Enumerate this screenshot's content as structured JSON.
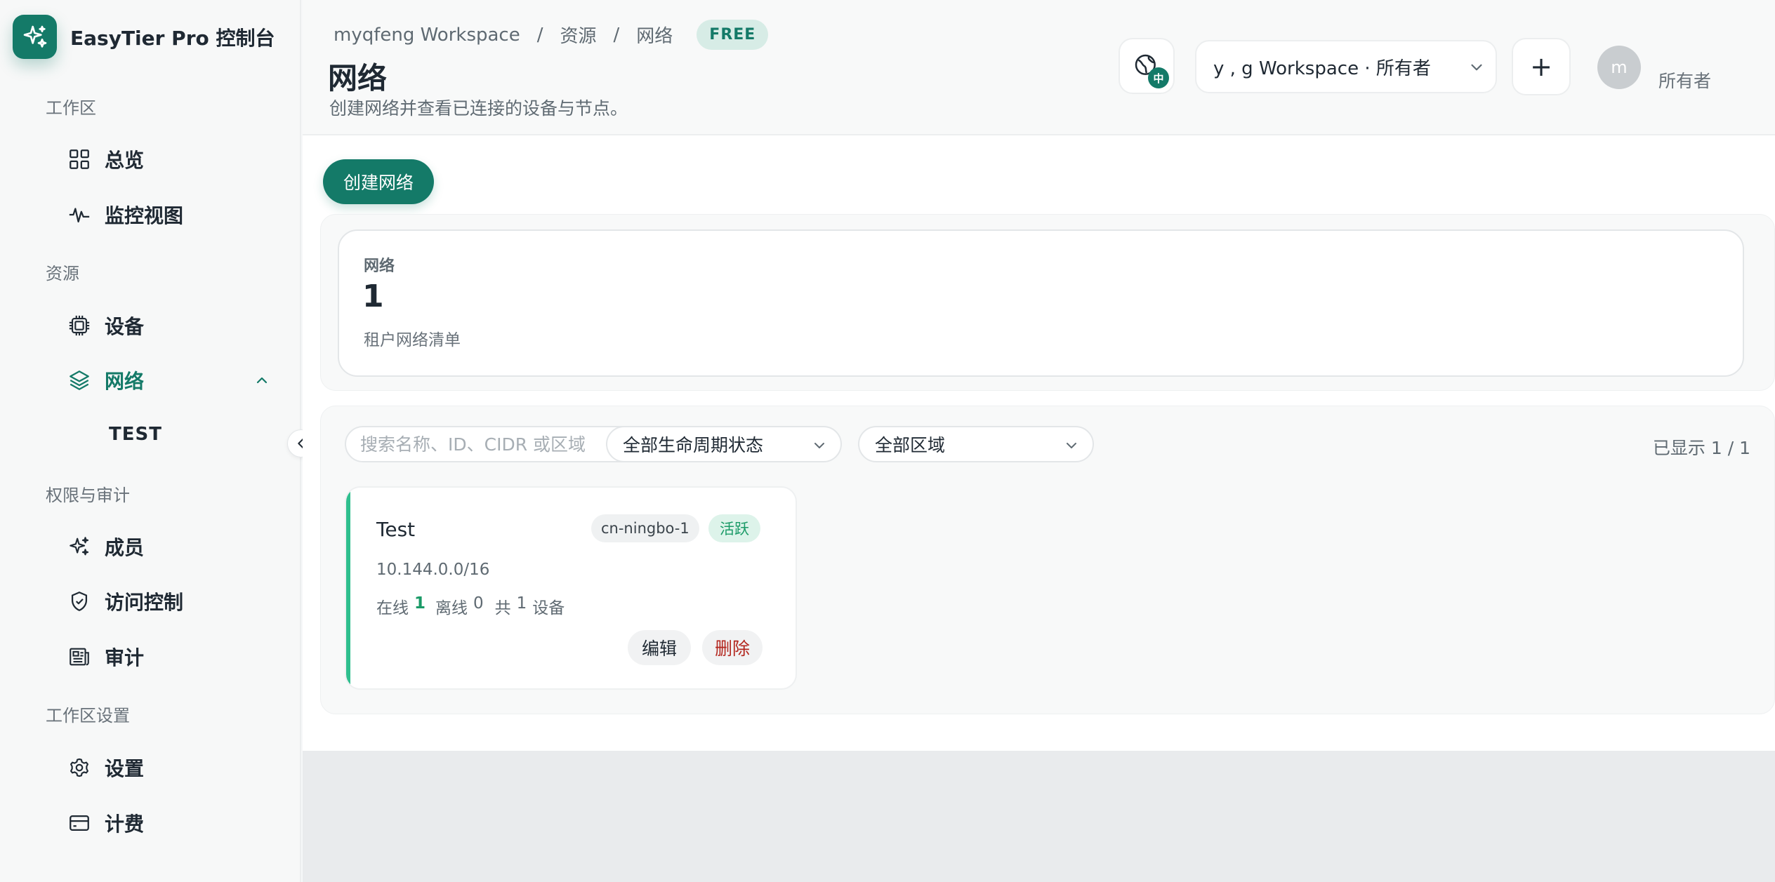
{
  "brand": {
    "title": "EasyTier Pro 控制台"
  },
  "sidebar": {
    "sections": [
      "工作区",
      "资源",
      "权限与审计",
      "工作区设置"
    ],
    "items": [
      {
        "label": "总览",
        "icon": "grid-icon"
      },
      {
        "label": "监控视图",
        "icon": "pulse-icon"
      },
      {
        "label": "设备",
        "icon": "chip-icon"
      },
      {
        "label": "网络",
        "icon": "layers-icon",
        "active": true
      },
      {
        "label": "成员",
        "icon": "sparkle-icon"
      },
      {
        "label": "访问控制",
        "icon": "shield-icon"
      },
      {
        "label": "审计",
        "icon": "newspaper-icon"
      },
      {
        "label": "设置",
        "icon": "gear-icon"
      },
      {
        "label": "计费",
        "icon": "credit-card-icon"
      }
    ],
    "sub_item": "TEST"
  },
  "header": {
    "breadcrumb": [
      "myqfeng Workspace",
      "资源",
      "网络"
    ],
    "breadcrumb_sep": "/",
    "plan_badge": "FREE",
    "title": "网络",
    "subtitle": "创建网络并查看已连接的设备与节点。",
    "lang_badge": "中",
    "workspace_select": "y , g Workspace · 所有者",
    "add_label": "+",
    "avatar_initial": "m",
    "role": "所有者"
  },
  "main": {
    "create_button": "创建网络",
    "stats": {
      "label": "网络",
      "value": "1",
      "desc": "租户网络清单"
    },
    "filters": {
      "search_placeholder": "搜索名称、ID、CIDR 或区域",
      "lifecycle": "全部生命周期状态",
      "region": "全部区域",
      "shown": "已显示 1 / 1"
    },
    "networks": [
      {
        "name": "Test",
        "region": "cn-ningbo-1",
        "status": "活跃",
        "cidr": "10.144.0.0/16",
        "online_label": "在线",
        "online": "1",
        "offline_label": "离线",
        "offline": "0",
        "total_label": "共",
        "total": "1",
        "device_label": "设备",
        "edit": "编辑",
        "delete": "删除"
      }
    ]
  },
  "colors": {
    "accent": "#147a68",
    "active_green": "#1a9a67",
    "danger": "#b3261e",
    "card_accent": "#2fbf8e"
  }
}
